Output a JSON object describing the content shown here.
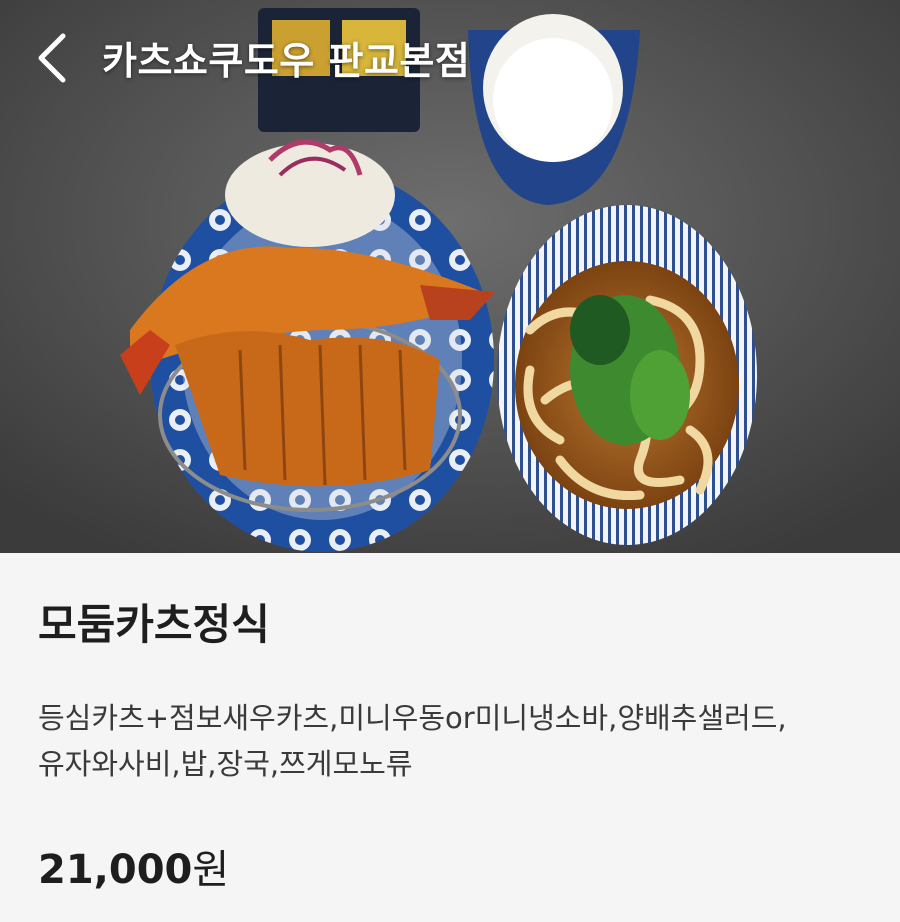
{
  "header": {
    "back_icon": "chevron-left-icon",
    "title": "카츠쇼쿠도우 판교본점"
  },
  "hero": {
    "image": "menu-photo",
    "description_icon": "food-photo"
  },
  "menu_item": {
    "name": "모둠카츠정식",
    "description_lines": [
      "등심카츠+점보새우카츠,미니우동or미니냉소바,양배추샐러드,",
      "유자와사비,밥,장국,쯔게모노류"
    ],
    "price_amount": "21,000",
    "price_unit": "원"
  },
  "colors": {
    "background": "#f5f5f5",
    "text_primary": "#1e1e1e",
    "text_secondary": "#3a3a3a",
    "header_text": "#ffffff"
  }
}
